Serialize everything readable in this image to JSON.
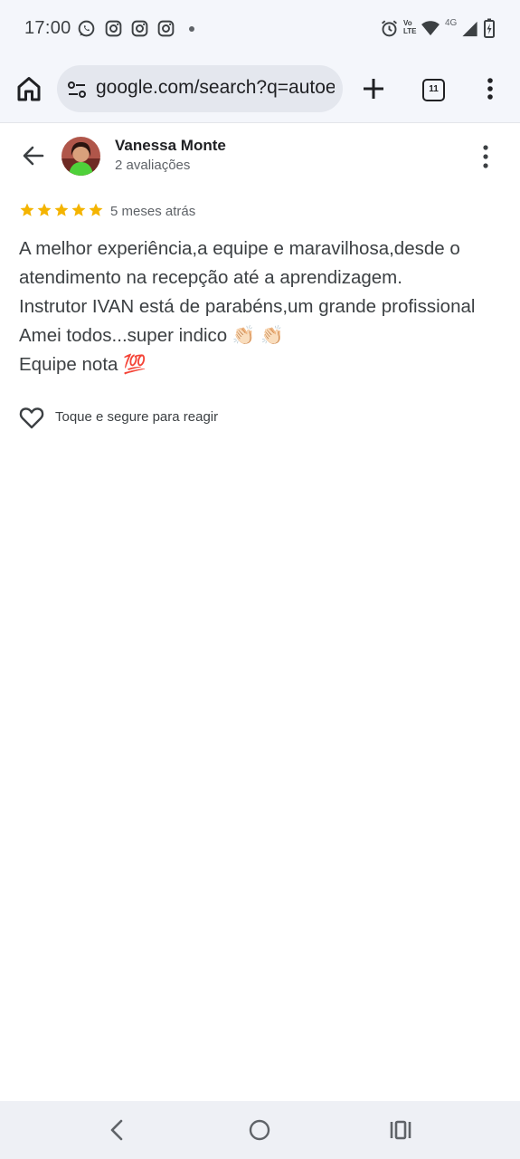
{
  "status_bar": {
    "time": "17:00",
    "left_icons": [
      "whatsapp-icon",
      "instagram-icon",
      "instagram-icon",
      "instagram-icon",
      "dot-icon"
    ],
    "right_icons": [
      "alarm-icon",
      "volte-icon",
      "wifi-icon",
      "4g-icon",
      "signal-icon",
      "battery-charging-icon"
    ],
    "volte_label": "Vo LTE",
    "network_label": "4G"
  },
  "browser": {
    "url": "google.com/search?q=autoescola",
    "tab_count": "11"
  },
  "review": {
    "reviewer_name": "Vanessa Monte",
    "review_count": "2 avaliações",
    "rating": 5,
    "rating_max": 5,
    "time_ago": "5 meses atrás",
    "lines": [
      "A melhor experiência,a equipe e maravilhosa,desde o",
      "atendimento na recepção até a aprendizagem.",
      "Instrutor IVAN está de parabéns,um grande profissional",
      "Amei todos...super indico 👏🏻 👏🏻",
      "Equipe nota 💯"
    ],
    "react_label": "Toque e segure para reagir"
  },
  "colors": {
    "star": "#f4b400",
    "chrome_bg": "#f4f6fb",
    "omnibox_bg": "#e4e7ee",
    "text_primary": "#202124",
    "text_secondary": "#5f6368"
  },
  "nav_bar": {
    "buttons": [
      "back-nav-icon",
      "home-nav-icon",
      "recents-nav-icon"
    ]
  }
}
